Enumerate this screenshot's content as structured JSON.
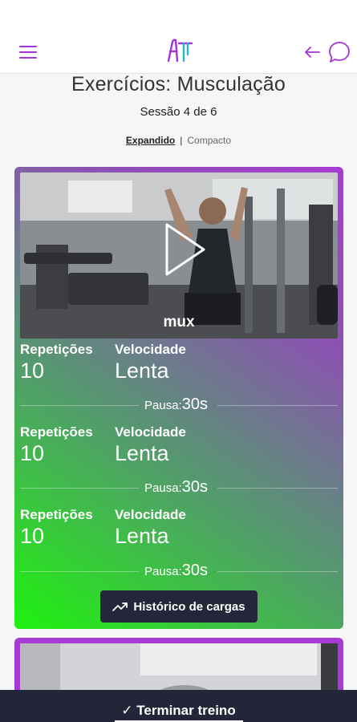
{
  "header": {
    "menu_icon": "hamburger-menu-icon",
    "logo_icon": "app-logo-icon",
    "back_icon": "arrow-left-icon",
    "chat_icon": "chat-bubble-icon",
    "accent_color": "#a234d8"
  },
  "page": {
    "title": "Exercícios: Musculação",
    "session": "Sessão 4 de 6",
    "view_expanded": "Expandido",
    "view_separator": "|",
    "view_compact": "Compacto"
  },
  "exercise": {
    "video_label": "mux",
    "play_icon": "play-icon",
    "sets": [
      {
        "reps_label": "Repetições",
        "reps": "10",
        "speed_label": "Velocidade",
        "speed": "Lenta",
        "pause_label": "Pausa:",
        "pause": "30s"
      },
      {
        "reps_label": "Repetições",
        "reps": "10",
        "speed_label": "Velocidade",
        "speed": "Lenta",
        "pause_label": "Pausa:",
        "pause": "30s"
      },
      {
        "reps_label": "Repetições",
        "reps": "10",
        "speed_label": "Velocidade",
        "speed": "Lenta",
        "pause_label": "Pausa:",
        "pause": "30s"
      }
    ],
    "history_button": "Histórico de cargas",
    "history_icon": "trending-up-icon",
    "gradient_colors": [
      "#a83bd3",
      "#1ff20f"
    ]
  },
  "footer": {
    "finish_button": "✓ Terminar treino",
    "bar_color": "#232638"
  }
}
